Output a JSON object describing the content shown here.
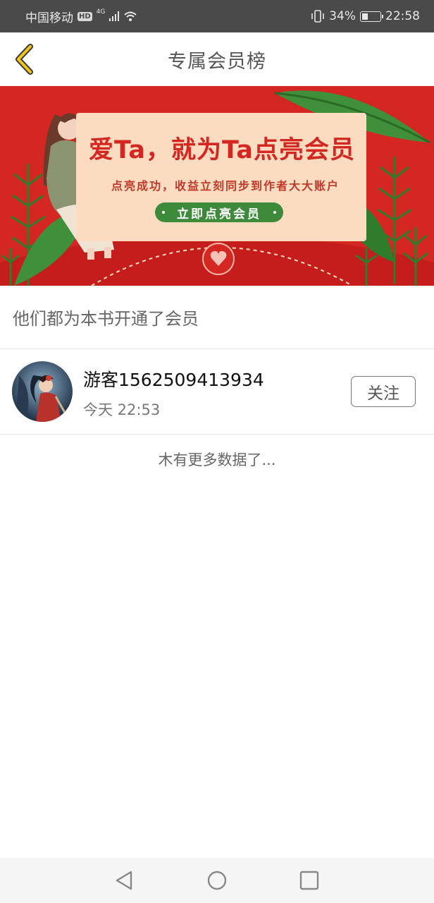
{
  "status_bar": {
    "carrier": "中国移动",
    "hd": "HD",
    "network": "4G",
    "battery_percent": "34%",
    "battery_level": 0.34,
    "time": "22:58"
  },
  "nav": {
    "title": "专属会员榜",
    "back_icon": "chevron-left-icon"
  },
  "banner": {
    "headline": "爱Ta，就为Ta点亮会员",
    "subtitle": "点亮成功，收益立刻同步到作者大大账户",
    "cta_label": "立即点亮会员"
  },
  "section": {
    "title": "他们都为本书开通了会员"
  },
  "members": [
    {
      "name": "游客1562509413934",
      "time": "今天 22:53",
      "follow_label": "关注"
    }
  ],
  "footer_message": "木有更多数据了...",
  "colors": {
    "accent_red": "#d42722",
    "back_arrow": "#f0c419",
    "cta_green": "#3d8a3a",
    "status_bar": "#4a4a4a"
  }
}
